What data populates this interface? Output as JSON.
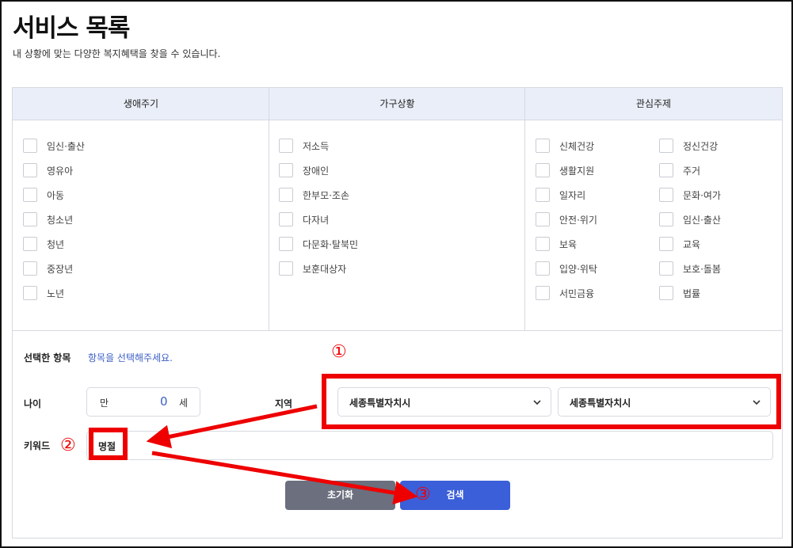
{
  "header": {
    "title": "서비스 목록",
    "subtitle": "내 상황에 맞는 다양한 복지혜택을 찾을 수 있습니다."
  },
  "categories": {
    "life_cycle": {
      "heading": "생애주기",
      "options": [
        "임신·출산",
        "영유아",
        "아동",
        "청소년",
        "청년",
        "중장년",
        "노년"
      ]
    },
    "household": {
      "heading": "가구상황",
      "options": [
        "저소득",
        "장애인",
        "한부모·조손",
        "다자녀",
        "다문화·탈북민",
        "보훈대상자"
      ]
    },
    "interest": {
      "heading": "관심주제",
      "options_left": [
        "신체건강",
        "생활지원",
        "일자리",
        "안전·위기",
        "보육",
        "입양·위탁",
        "서민금융"
      ],
      "options_right": [
        "정신건강",
        "주거",
        "문화·여가",
        "임신·출산",
        "교육",
        "보호·돌봄",
        "법률"
      ]
    }
  },
  "filters": {
    "selected_label": "선택한 항목",
    "selected_hint": "항목을 선택해주세요.",
    "age_label": "나이",
    "age_prefix": "만",
    "age_value": "0",
    "age_unit": "세",
    "region_label": "지역",
    "region_primary": "세종특별자치시",
    "region_secondary": "세종특별자치시",
    "keyword_label": "키워드",
    "keyword_value": "명절"
  },
  "buttons": {
    "reset": "초기화",
    "search": "검색"
  },
  "annotations": {
    "marker_1": "①",
    "marker_2": "②",
    "marker_3": "③",
    "color": "#ee0000"
  },
  "colors": {
    "accent": "#3b5fd8",
    "header_bg": "#eaeef8",
    "reset_bg": "#6b6f7e"
  }
}
